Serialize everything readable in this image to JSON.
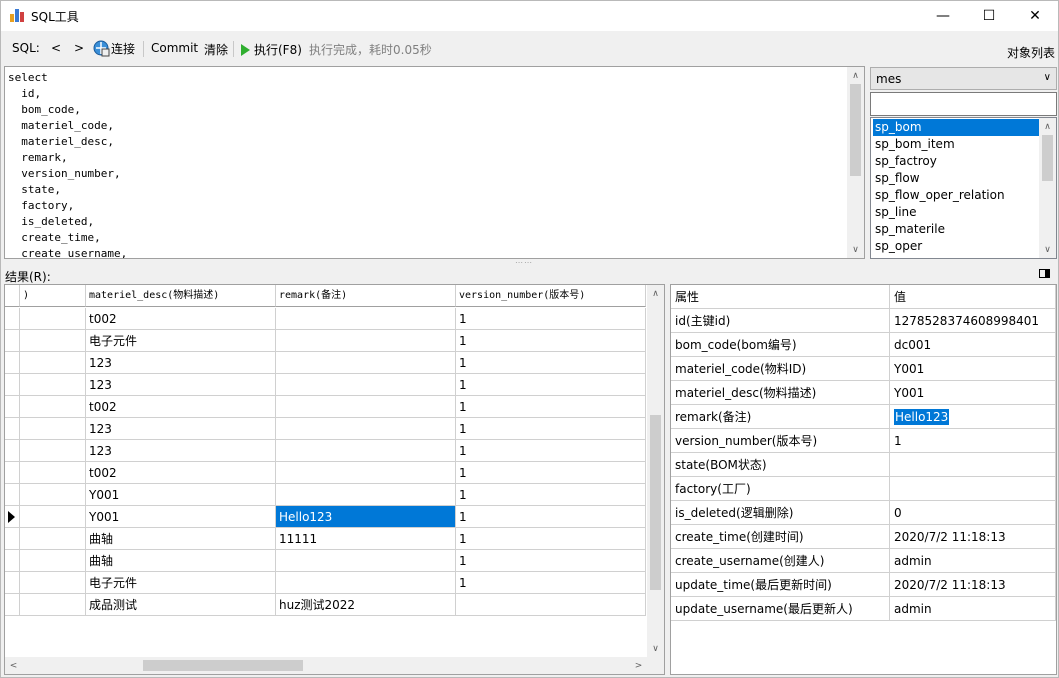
{
  "window": {
    "title": "SQL工具",
    "minimize": "—",
    "maximize": "☐",
    "close": "✕"
  },
  "toolbar": {
    "sql_label": "SQL:",
    "prev": "<",
    "next": ">",
    "connect": "连接",
    "commit": "Commit",
    "clear": "清除",
    "execute": "执行(F8)",
    "status": "执行完成，耗时0.05秒",
    "object_list": "对象列表"
  },
  "editor": {
    "sql": "select\n  id,\n  bom_code,\n  materiel_code,\n  materiel_desc,\n  remark,\n  version_number,\n  state,\n  factory,\n  is_deleted,\n  create_time,\n  create_username,"
  },
  "objects": {
    "database": "mes",
    "filter": "",
    "items": [
      "sp_bom",
      "sp_bom_item",
      "sp_factroy",
      "sp_flow",
      "sp_flow_oper_relation",
      "sp_line",
      "sp_materile",
      "sp_oper"
    ],
    "selected_index": 0
  },
  "results": {
    "label": "结果(R):",
    "columns": [
      ")",
      "materiel_desc(物料描述)",
      "remark(备注)",
      "version_number(版本号)"
    ],
    "rows": [
      [
        "",
        "t002",
        "",
        "1"
      ],
      [
        "",
        "电子元件",
        "",
        "1"
      ],
      [
        "",
        "123",
        "",
        "1"
      ],
      [
        "",
        "123",
        "",
        "1"
      ],
      [
        "",
        "t002",
        "",
        "1"
      ],
      [
        "",
        "123",
        "",
        "1"
      ],
      [
        "",
        "123",
        "",
        "1"
      ],
      [
        "",
        "t002",
        "",
        "1"
      ],
      [
        "",
        "Y001",
        "",
        "1"
      ],
      [
        "",
        "Y001",
        "Hello123",
        "1"
      ],
      [
        "",
        "曲轴",
        "11111",
        "1"
      ],
      [
        "",
        "曲轴",
        "",
        "1"
      ],
      [
        "",
        "电子元件",
        "",
        "1"
      ],
      [
        "",
        "成品测试",
        "huz测试2022",
        ""
      ]
    ],
    "current_row": 9
  },
  "properties": {
    "header_attr": "属性",
    "header_value": "值",
    "rows": [
      {
        "attr": "id(主键id)",
        "value": "1278528374608998401"
      },
      {
        "attr": "bom_code(bom编号)",
        "value": "dc001"
      },
      {
        "attr": "materiel_code(物料ID)",
        "value": "Y001"
      },
      {
        "attr": "materiel_desc(物料描述)",
        "value": "Y001"
      },
      {
        "attr": "remark(备注)",
        "value": "Hello123"
      },
      {
        "attr": "version_number(版本号)",
        "value": "1"
      },
      {
        "attr": "state(BOM状态)",
        "value": ""
      },
      {
        "attr": "factory(工厂)",
        "value": ""
      },
      {
        "attr": "is_deleted(逻辑删除)",
        "value": "0"
      },
      {
        "attr": "create_time(创建时间)",
        "value": "2020/7/2 11:18:13"
      },
      {
        "attr": "create_username(创建人)",
        "value": "admin"
      },
      {
        "attr": "update_time(最后更新时间)",
        "value": "2020/7/2 11:18:13"
      },
      {
        "attr": "update_username(最后更新人)",
        "value": "admin"
      }
    ],
    "selected_index": 4
  }
}
